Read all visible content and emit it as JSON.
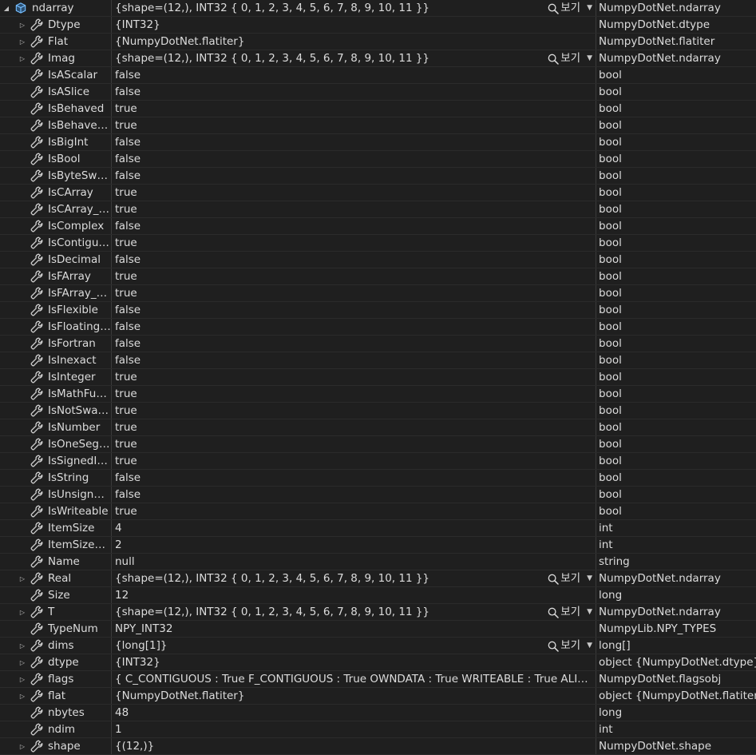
{
  "rows": [
    {
      "name": "ndarray",
      "value": "{shape=(12,), INT32 { 0, 1, 2, 3, 4, 5, 6, 7, 8, 9, 10, 11 }}",
      "type": "NumpyDotNet.ndarray",
      "expanded": true,
      "expandable": true,
      "level": 0,
      "icon": "cube-icon",
      "viewer": true
    },
    {
      "name": "Dtype",
      "value": "{INT32}",
      "type": "NumpyDotNet.dtype",
      "expandable": true,
      "level": 1,
      "icon": "wrench-icon"
    },
    {
      "name": "Flat",
      "value": "{NumpyDotNet.flatiter}",
      "type": "NumpyDotNet.flatiter",
      "expandable": true,
      "level": 1,
      "icon": "wrench-icon"
    },
    {
      "name": "Imag",
      "value": "{shape=(12,), INT32 { 0, 1, 2, 3, 4, 5, 6, 7, 8, 9, 10, 11 }}",
      "type": "NumpyDotNet.ndarray",
      "expandable": true,
      "level": 1,
      "icon": "wrench-icon",
      "viewer": true
    },
    {
      "name": "IsAScalar",
      "value": "false",
      "type": "bool",
      "level": 1,
      "icon": "wrench-icon"
    },
    {
      "name": "IsASlice",
      "value": "false",
      "type": "bool",
      "level": 1,
      "icon": "wrench-icon"
    },
    {
      "name": "IsBehaved",
      "value": "true",
      "type": "bool",
      "level": 1,
      "icon": "wrench-icon"
    },
    {
      "name": "IsBehaved…",
      "value": "true",
      "type": "bool",
      "level": 1,
      "icon": "wrench-icon"
    },
    {
      "name": "IsBigInt",
      "value": "false",
      "type": "bool",
      "level": 1,
      "icon": "wrench-icon"
    },
    {
      "name": "IsBool",
      "value": "false",
      "type": "bool",
      "level": 1,
      "icon": "wrench-icon"
    },
    {
      "name": "IsByteSwa…",
      "value": "false",
      "type": "bool",
      "level": 1,
      "icon": "wrench-icon"
    },
    {
      "name": "IsCArray",
      "value": "true",
      "type": "bool",
      "level": 1,
      "icon": "wrench-icon"
    },
    {
      "name": "IsCArray_…",
      "value": "true",
      "type": "bool",
      "level": 1,
      "icon": "wrench-icon"
    },
    {
      "name": "IsComplex",
      "value": "false",
      "type": "bool",
      "level": 1,
      "icon": "wrench-icon"
    },
    {
      "name": "IsContigu…",
      "value": "true",
      "type": "bool",
      "level": 1,
      "icon": "wrench-icon"
    },
    {
      "name": "IsDecimal",
      "value": "false",
      "type": "bool",
      "level": 1,
      "icon": "wrench-icon"
    },
    {
      "name": "IsFArray",
      "value": "true",
      "type": "bool",
      "level": 1,
      "icon": "wrench-icon"
    },
    {
      "name": "IsFArray_RO",
      "value": "true",
      "type": "bool",
      "level": 1,
      "icon": "wrench-icon"
    },
    {
      "name": "IsFlexible",
      "value": "false",
      "type": "bool",
      "level": 1,
      "icon": "wrench-icon"
    },
    {
      "name": "IsFloating…",
      "value": "false",
      "type": "bool",
      "level": 1,
      "icon": "wrench-icon"
    },
    {
      "name": "IsFortran",
      "value": "false",
      "type": "bool",
      "level": 1,
      "icon": "wrench-icon"
    },
    {
      "name": "IsInexact",
      "value": "false",
      "type": "bool",
      "level": 1,
      "icon": "wrench-icon"
    },
    {
      "name": "IsInteger",
      "value": "true",
      "type": "bool",
      "level": 1,
      "icon": "wrench-icon"
    },
    {
      "name": "IsMathFun…",
      "value": "true",
      "type": "bool",
      "level": 1,
      "icon": "wrench-icon"
    },
    {
      "name": "IsNotSwa…",
      "value": "true",
      "type": "bool",
      "level": 1,
      "icon": "wrench-icon"
    },
    {
      "name": "IsNumber",
      "value": "true",
      "type": "bool",
      "level": 1,
      "icon": "wrench-icon"
    },
    {
      "name": "IsOneSeg…",
      "value": "true",
      "type": "bool",
      "level": 1,
      "icon": "wrench-icon"
    },
    {
      "name": "IsSignedIn…",
      "value": "true",
      "type": "bool",
      "level": 1,
      "icon": "wrench-icon"
    },
    {
      "name": "IsString",
      "value": "false",
      "type": "bool",
      "level": 1,
      "icon": "wrench-icon"
    },
    {
      "name": "IsUnsigne…",
      "value": "false",
      "type": "bool",
      "level": 1,
      "icon": "wrench-icon"
    },
    {
      "name": "IsWriteable",
      "value": "true",
      "type": "bool",
      "level": 1,
      "icon": "wrench-icon"
    },
    {
      "name": "ItemSize",
      "value": "4",
      "type": "int",
      "level": 1,
      "icon": "wrench-icon"
    },
    {
      "name": "ItemSizeD…",
      "value": "2",
      "type": "int",
      "level": 1,
      "icon": "wrench-icon"
    },
    {
      "name": "Name",
      "value": "null",
      "type": "string",
      "level": 1,
      "icon": "wrench-icon"
    },
    {
      "name": "Real",
      "value": "{shape=(12,), INT32 { 0, 1, 2, 3, 4, 5, 6, 7, 8, 9, 10, 11 }}",
      "type": "NumpyDotNet.ndarray",
      "expandable": true,
      "level": 1,
      "icon": "wrench-icon",
      "viewer": true
    },
    {
      "name": "Size",
      "value": "12",
      "type": "long",
      "level": 1,
      "icon": "wrench-icon"
    },
    {
      "name": "T",
      "value": "{shape=(12,), INT32 { 0, 1, 2, 3, 4, 5, 6, 7, 8, 9, 10, 11 }}",
      "type": "NumpyDotNet.ndarray",
      "expandable": true,
      "level": 1,
      "icon": "wrench-icon",
      "viewer": true
    },
    {
      "name": "TypeNum",
      "value": "NPY_INT32",
      "type": "NumpyLib.NPY_TYPES",
      "level": 1,
      "icon": "wrench-icon"
    },
    {
      "name": "dims",
      "value": "{long[1]}",
      "type": "long[]",
      "expandable": true,
      "level": 1,
      "icon": "wrench-icon",
      "viewer": true
    },
    {
      "name": "dtype",
      "value": "{INT32}",
      "type": "object {NumpyDotNet.dtype}",
      "expandable": true,
      "level": 1,
      "icon": "wrench-icon"
    },
    {
      "name": "flags",
      "value": "{  C_CONTIGUOUS : True  F_CONTIGUOUS : True  OWNDATA : True  WRITEABLE : True  ALI…",
      "type": "NumpyDotNet.flagsobj",
      "expandable": true,
      "level": 1,
      "icon": "wrench-icon"
    },
    {
      "name": "flat",
      "value": "{NumpyDotNet.flatiter}",
      "type": "object {NumpyDotNet.flatiter}",
      "expandable": true,
      "level": 1,
      "icon": "wrench-icon"
    },
    {
      "name": "nbytes",
      "value": "48",
      "type": "long",
      "level": 1,
      "icon": "wrench-icon"
    },
    {
      "name": "ndim",
      "value": "1",
      "type": "int",
      "level": 1,
      "icon": "wrench-icon"
    },
    {
      "name": "shape",
      "value": "{(12,)}",
      "type": "NumpyDotNet.shape",
      "expandable": true,
      "level": 1,
      "icon": "wrench-icon"
    }
  ],
  "viewer_label": "보기",
  "colors": {
    "background": "#1f1f1f",
    "text": "#dcdcdc",
    "separator": "#3a3a3a",
    "cube_icon": "#75beff",
    "wrench_icon": "#d0d0d0"
  }
}
